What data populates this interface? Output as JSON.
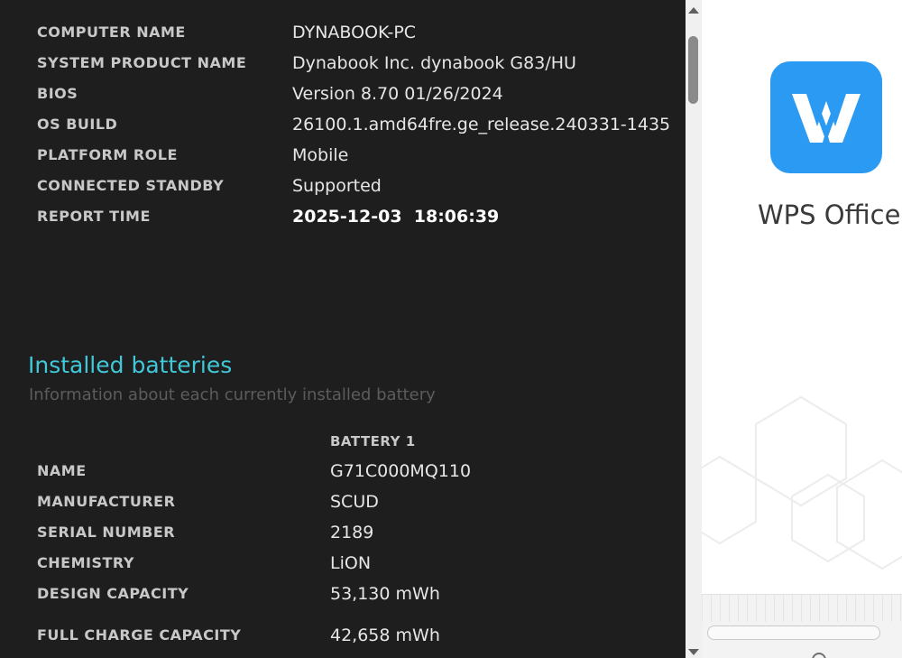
{
  "system_info": [
    {
      "label": "COMPUTER NAME",
      "value": "DYNABOOK-PC"
    },
    {
      "label": "SYSTEM PRODUCT NAME",
      "value": "Dynabook Inc. dynabook G83/HU"
    },
    {
      "label": "BIOS",
      "value": "Version 8.70 01/26/2024"
    },
    {
      "label": "OS BUILD",
      "value": "26100.1.amd64fre.ge_release.240331-1435"
    },
    {
      "label": "PLATFORM ROLE",
      "value": "Mobile"
    },
    {
      "label": "CONNECTED STANDBY",
      "value": "Supported"
    },
    {
      "label": "REPORT TIME",
      "value": "2025-12-03  18:06:39"
    }
  ],
  "installed_batteries": {
    "title": "Installed batteries",
    "subtitle": "Information about each currently installed battery",
    "column_header": "BATTERY 1",
    "rows": [
      {
        "label": "NAME",
        "value": "G71C000MQ110"
      },
      {
        "label": "MANUFACTURER",
        "value": "SCUD"
      },
      {
        "label": "SERIAL NUMBER",
        "value": "2189"
      },
      {
        "label": "CHEMISTRY",
        "value": "LiON"
      },
      {
        "label": "DESIGN CAPACITY",
        "value": "53,130 mWh"
      },
      {
        "label": "FULL CHARGE CAPACITY",
        "value": "42,658 mWh"
      }
    ]
  },
  "side_window": {
    "app_name": "WPS Office",
    "logo_icon": "wps-logo-icon",
    "brand_color": "#2b9af3"
  },
  "colors": {
    "background": "#1e1e1e",
    "section_title": "#41c8d8",
    "label": "#c8c8c8",
    "value": "#e6e6e6"
  }
}
